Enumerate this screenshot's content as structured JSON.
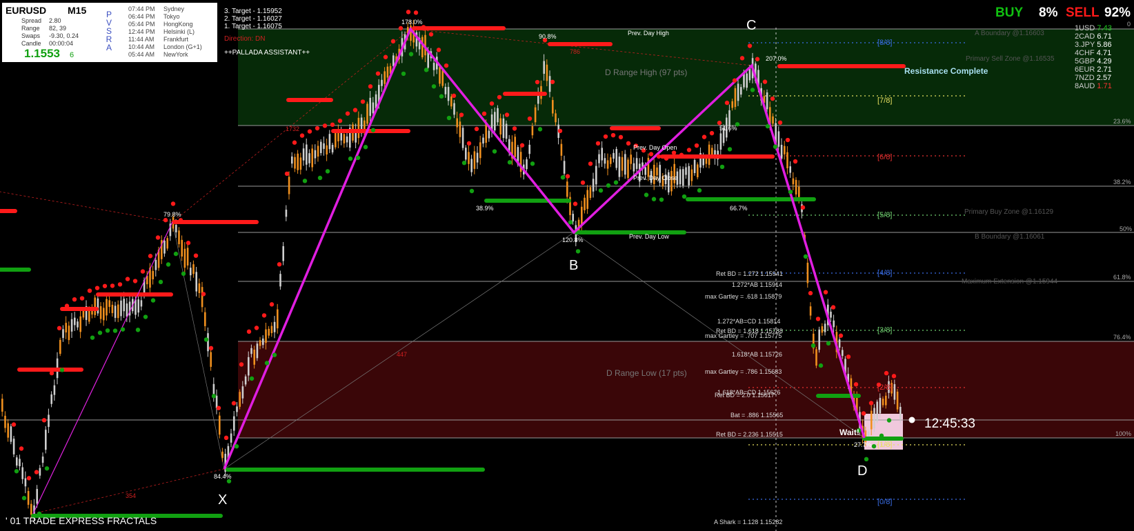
{
  "header": {
    "symbol": "EURUSD",
    "timeframe": "M15",
    "spread_label": "Spread",
    "spread": "2.80",
    "range_label": "Range",
    "range": "82, 39",
    "swaps_label": "Swaps",
    "swaps": "-9.30, 0.24",
    "candle_label": "Candle",
    "candle": "00:00:04",
    "bid_main": "1.1553",
    "bid_small": "6",
    "pvsra": [
      "P",
      "V",
      "S",
      "R",
      "A"
    ]
  },
  "sessions": [
    {
      "time": "07:44 PM",
      "city": "Sydney"
    },
    {
      "time": "06:44 PM",
      "city": "Tokyo"
    },
    {
      "time": "05:44 PM",
      "city": "HongKong"
    },
    {
      "time": "12:44 PM",
      "city": "Helsinki  (L)"
    },
    {
      "time": "11:44 AM",
      "city": "Frankfurt"
    },
    {
      "time": "10:44 AM",
      "city": "London   (G+1)"
    },
    {
      "time": "05:44 AM",
      "city": "NewYork"
    }
  ],
  "targets": [
    "3. Target - 1.15952",
    "2. Target - 1.16027",
    "1. Target - 1.16075"
  ],
  "direction": "Direction: DN",
  "assistant": "++PALLADA ASSISTANT++",
  "sentiment": {
    "buy_label": "BUY",
    "buy_pct": "8%",
    "sell_label": "SELL",
    "sell_pct": "92%",
    "buy_color": "#11c011",
    "sell_color": "#ff1a1a"
  },
  "currencies": [
    {
      "label": "1USD",
      "value": "7.43",
      "color": "#22cc22"
    },
    {
      "label": "2CAD",
      "value": "6.71",
      "color": "#ffffff"
    },
    {
      "label": "3.JPY",
      "value": "5.86",
      "color": "#ffffff"
    },
    {
      "label": "4CHF",
      "value": "4.71",
      "color": "#ffffff"
    },
    {
      "label": "5GBP",
      "value": "4.29",
      "color": "#ffffff"
    },
    {
      "label": "6EUR",
      "value": "2.71",
      "color": "#ffffff"
    },
    {
      "label": "7NZD",
      "value": "2.57",
      "color": "#ffffff"
    },
    {
      "label": "8AUD",
      "value": "1.71",
      "color": "#ff3333"
    }
  ],
  "murrey": [
    "[8/8]",
    "[7/8]",
    "[6/8]",
    "[5/8]",
    "[4/8]",
    "[3/8]",
    "[2/8]",
    "[1/8]",
    "[0/8]"
  ],
  "right_levels": [
    "0",
    "23.6%",
    "38.2%",
    "50%",
    "61.8%",
    "76.4%",
    "100%"
  ],
  "zones": {
    "a_boundary": "A Boundary @1.16603",
    "primary_sell": "Primary Sell Zone @1.16535",
    "resistance": "Resistance Complete",
    "primary_buy": "Primary Buy Zone @1.16129",
    "b_boundary": "B Boundary @1.16061",
    "max_extension": "Maximum Extension @1.15944"
  },
  "day_labels": {
    "high": "Prev. Day High",
    "open": "Prev. Day Open",
    "close": "Prev. Day Close",
    "low": "Prev. Day Low",
    "range_high": "D Range High (97 pts)",
    "range_low": "D Range Low (17 pts)"
  },
  "fib_labels": [
    "Ret BD = 1.272  1.15941",
    "1.272*AB  1.15914",
    "max Gartley = .618  1.15879",
    "1.272*AB=CD  1.15814",
    "Ret BD = 1.618  1.15788",
    "max Gartley = .707  1.15775",
    "1.618*AB  1.15726",
    "max Gartley = .786  1.15683",
    "1.618*AB=CD  1.15626",
    "Ret BD = 2.0  1.15617",
    "Bat = .886  1.15565",
    "Ret BD = 2.236  1.15515",
    "A Shark = 1.128  1.15282"
  ],
  "pattern_points": {
    "x": "X",
    "b": "B",
    "c": "C",
    "d": "D"
  },
  "pct_labels": {
    "p1": "178.0%",
    "p2": "90.8%",
    "p3": "79.8%",
    "p4": "38.9%",
    "p5": "120.8%",
    "p6": "51.6%",
    "p7": "66.7%",
    "p8": "207.0%",
    "p9": "84.4%",
    "p10": "27.7%"
  },
  "pips_labels": {
    "a": "447",
    "b": "354",
    "c": "786",
    "d": "1732"
  },
  "wait_label": "Wait!",
  "clock": "12:45:33",
  "footer": "' 01 TRADE EXPRESS FRACTALS"
}
